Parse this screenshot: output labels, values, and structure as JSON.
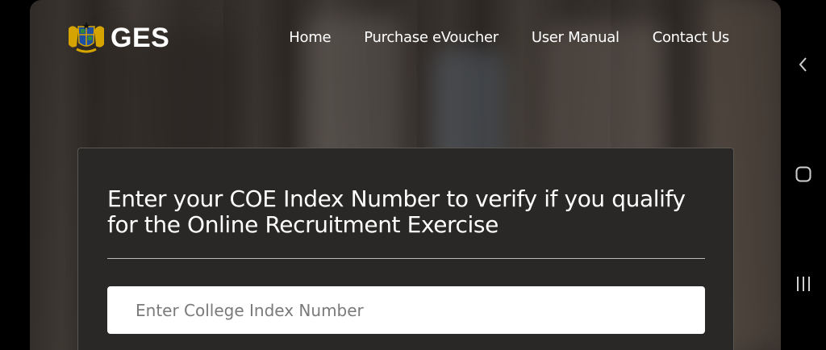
{
  "header": {
    "brand": "GES",
    "nav": [
      {
        "label": "Home"
      },
      {
        "label": "Purchase eVoucher"
      },
      {
        "label": "User Manual"
      },
      {
        "label": "Contact Us"
      }
    ]
  },
  "form": {
    "title": "Enter your COE Index Number to verify if you qualify for the Online Recruitment Exercise",
    "index_input": {
      "placeholder": "Enter College Index Number",
      "value": ""
    }
  },
  "system_nav": {
    "back_icon": "chevron-left-icon",
    "home_icon": "rounded-square-icon",
    "recents_icon": "three-bars-icon"
  },
  "colors": {
    "card_bg": "#2a2826",
    "text": "#ffffff",
    "crest_gold": "#d6a400"
  }
}
